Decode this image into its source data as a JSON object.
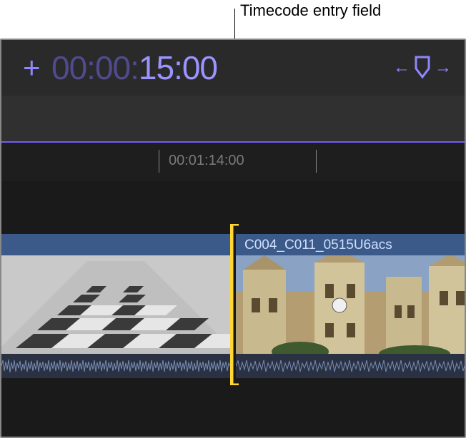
{
  "callout_label": "Timecode entry field",
  "toolbar": {
    "plus_label": "+",
    "timecode_dim": "00:00:",
    "timecode_bright": "15:00"
  },
  "icons": {
    "prev_marker": "←",
    "next_marker": "→"
  },
  "ruler": {
    "label": "00:01:14:00"
  },
  "clips": {
    "clip1_name": "",
    "clip2_name": "C004_C011_0515U6acs"
  },
  "colors": {
    "accent": "#8e87ff",
    "accent_dim": "#504a8f",
    "selection": "#ffd633",
    "clip_header": "#3b5a8a"
  }
}
